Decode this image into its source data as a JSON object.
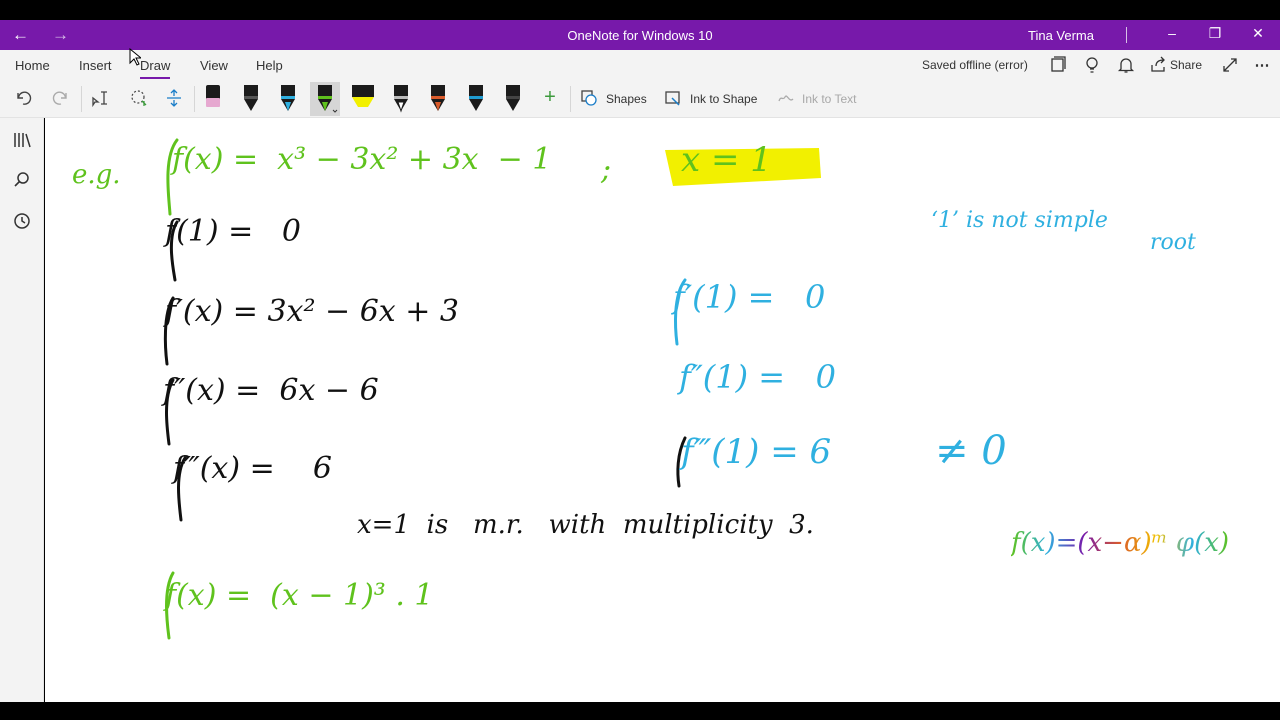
{
  "window": {
    "title": "OneNote for Windows 10",
    "user": "Tina Verma",
    "back_icon": "←",
    "forward_icon": "→"
  },
  "ribbon": {
    "tabs": [
      "Home",
      "Insert",
      "Draw",
      "View",
      "Help"
    ],
    "active_tab": "Draw",
    "status": "Saved offline (error)",
    "share_label": "Share"
  },
  "toolbar": {
    "shapes_label": "Shapes",
    "ink_to_shape_label": "Ink to Shape",
    "ink_to_text_label": "Ink to Text",
    "add_pen_label": "+"
  },
  "colors": {
    "accent": "#7719aa",
    "ink_green": "#5fc21d",
    "ink_black": "#111111",
    "ink_blue": "#2fb0e0",
    "highlight_yellow": "#f2f000"
  },
  "notes": {
    "eg": "e.g.",
    "line1": "f(x) =  x³ − 3x² + 3x  − 1",
    "semicolon": ";",
    "x_eq_1": "x = 1",
    "line2": "f(1) =   0",
    "line3": "f′(x) = 3x² − 6x + 3",
    "line4": "f″(x) =  6x − 6",
    "line5": "f‴(x) =    6",
    "conclusion": "x=1  is   m.r.   with  multiplicity  3.",
    "line6": "f(x) =  (x − 1)³ . 1",
    "blue1": "f′(1) =   0",
    "blue2": "f″(1) =   0",
    "blue3": "f‴(1) = 6",
    "neq_zero": "≠ 0",
    "note_side": "‘1’ is not simple",
    "note_side2": "root",
    "general_form": "f(x)=(x−α)ᵐ φ(x)"
  }
}
